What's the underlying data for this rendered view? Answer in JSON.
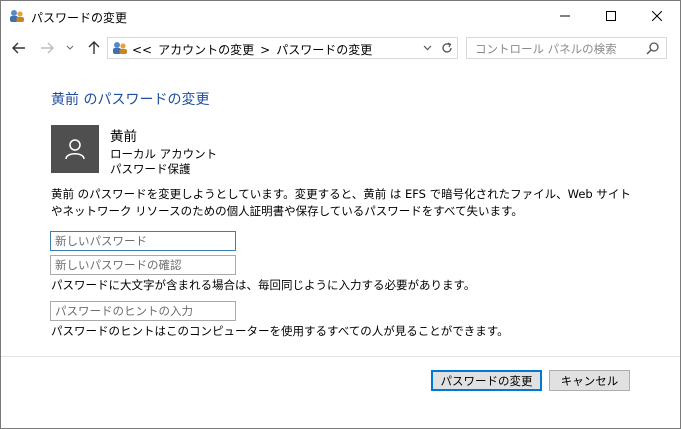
{
  "window": {
    "title": "パスワードの変更",
    "icon": "users-control-panel-icon",
    "controls": [
      "minimize-icon",
      "maximize-icon",
      "close-icon"
    ]
  },
  "nav": {
    "back": "arrow-left-icon",
    "forward": "arrow-right-icon",
    "recent": "chevron-down-icon",
    "up": "arrow-up-icon",
    "address": {
      "overflow": "<<",
      "crumbs": [
        "アカウントの変更",
        "パスワードの変更"
      ],
      "separator": ">"
    },
    "search": {
      "placeholder": "コントロール パネルの検索"
    }
  },
  "content": {
    "heading": "黄前 のパスワードの変更",
    "user": {
      "name": "黄前",
      "type": "ローカル アカウント",
      "protection": "パスワード保護"
    },
    "description": "黄前 のパスワードを変更しようとしています。変更すると、黄前 は EFS で暗号化されたファイル、Web サイトやネットワーク リソースのための個人証明書や保存しているパスワードをすべて失います。",
    "fields": {
      "new_password": "新しいパスワード",
      "confirm_password": "新しいパスワードの確認",
      "hint": "パスワードのヒントの入力"
    },
    "case_note": "パスワードに大文字が含まれる場合は、毎回同じように入力する必要があります。",
    "hint_note": "パスワードのヒントはこのコンピューターを使用するすべての人が見ることができます。"
  },
  "buttons": {
    "change": "パスワードの変更",
    "cancel": "キャンセル"
  },
  "colors": {
    "heading": "#1e4e9c",
    "accent": "#0078d7",
    "avatar_bg": "#4f4f4f"
  }
}
